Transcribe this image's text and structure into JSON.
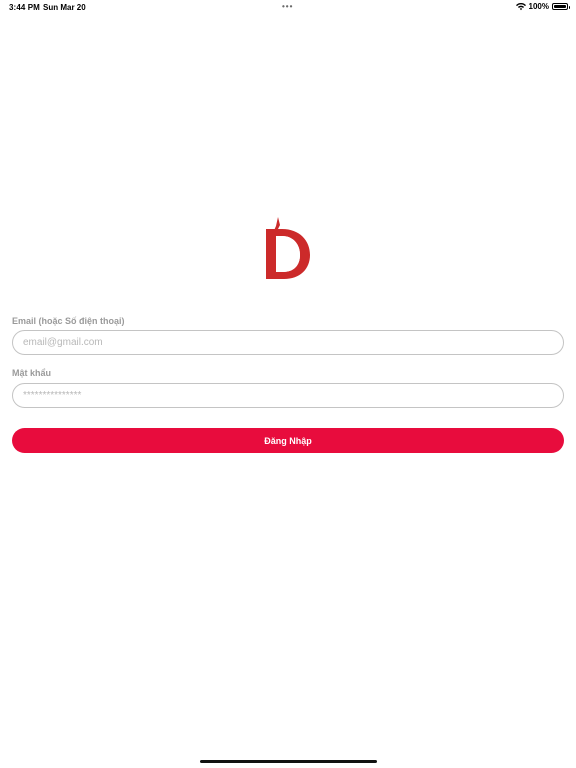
{
  "status_bar": {
    "time": "3:44 PM",
    "date": "Sun Mar 20",
    "multitask_dots": "•••",
    "wifi_icon": "wifi-icon",
    "battery_percent": "100%",
    "battery_level": 1.0
  },
  "logo": {
    "icon": "d-logo-icon",
    "color": "#cc2a2a"
  },
  "form": {
    "email": {
      "label": "Email (hoặc Số điện thoại)",
      "placeholder": "email@gmail.com",
      "value": ""
    },
    "password": {
      "label": "Mật khẩu",
      "placeholder": "***************",
      "value": ""
    },
    "submit_label": "Đăng Nhập"
  },
  "colors": {
    "accent": "#e80c3d",
    "label": "#9a9a9a",
    "input_border": "#c4c4c4"
  }
}
